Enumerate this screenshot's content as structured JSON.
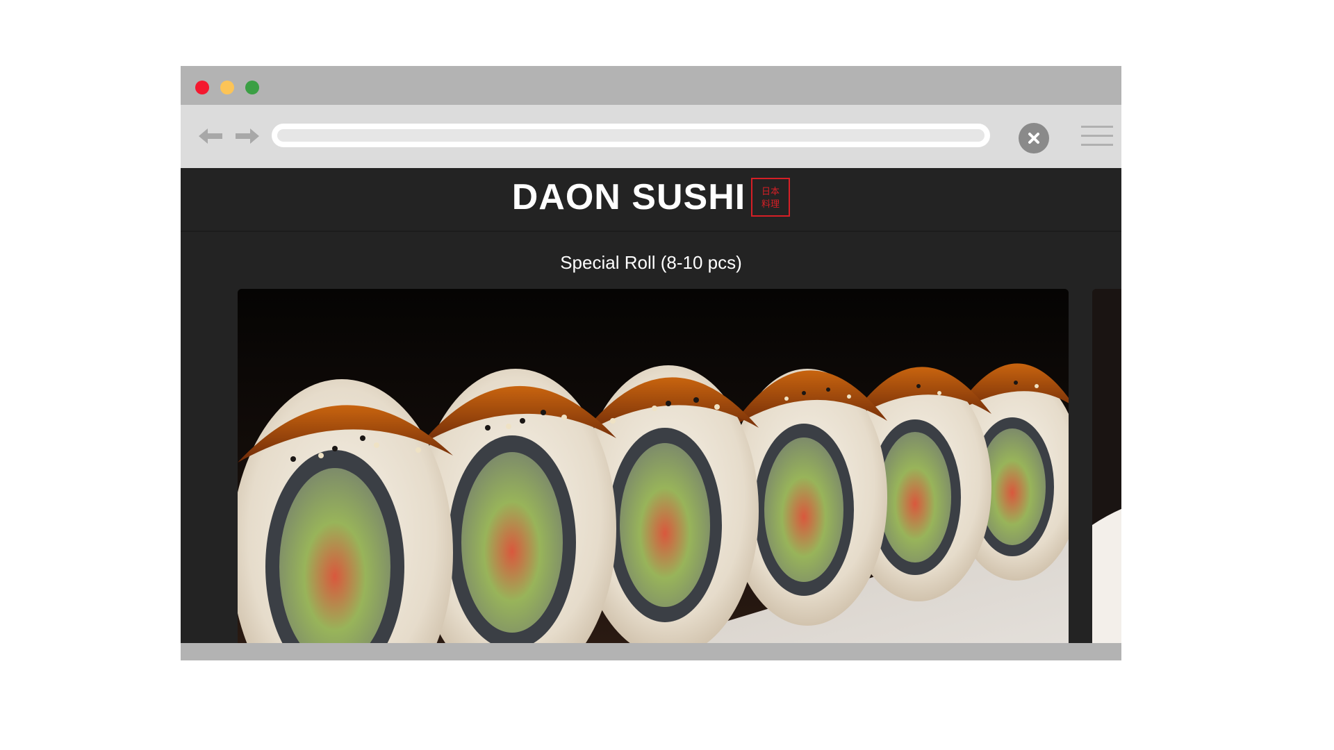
{
  "browser": {
    "url": "",
    "icons": {
      "back": "arrow-left-icon",
      "forward": "arrow-right-icon",
      "close": "close-icon",
      "menu": "hamburger-menu-icon"
    },
    "colors": {
      "close_dot": "#f4182f",
      "minimize_dot": "#fcc457",
      "maximize_dot": "#3b9f44",
      "chrome": "#b3b3b3",
      "toolbar": "#dcdcdc"
    }
  },
  "site": {
    "brand_name": "DAON SUSHI",
    "brand_seal_text": "日本料理",
    "colors": {
      "background": "#232323",
      "seal": "#d61f26"
    }
  },
  "menu": {
    "section_title": "Special Roll (8-10 pcs)",
    "featured_image": "sushi-roll-photo"
  }
}
